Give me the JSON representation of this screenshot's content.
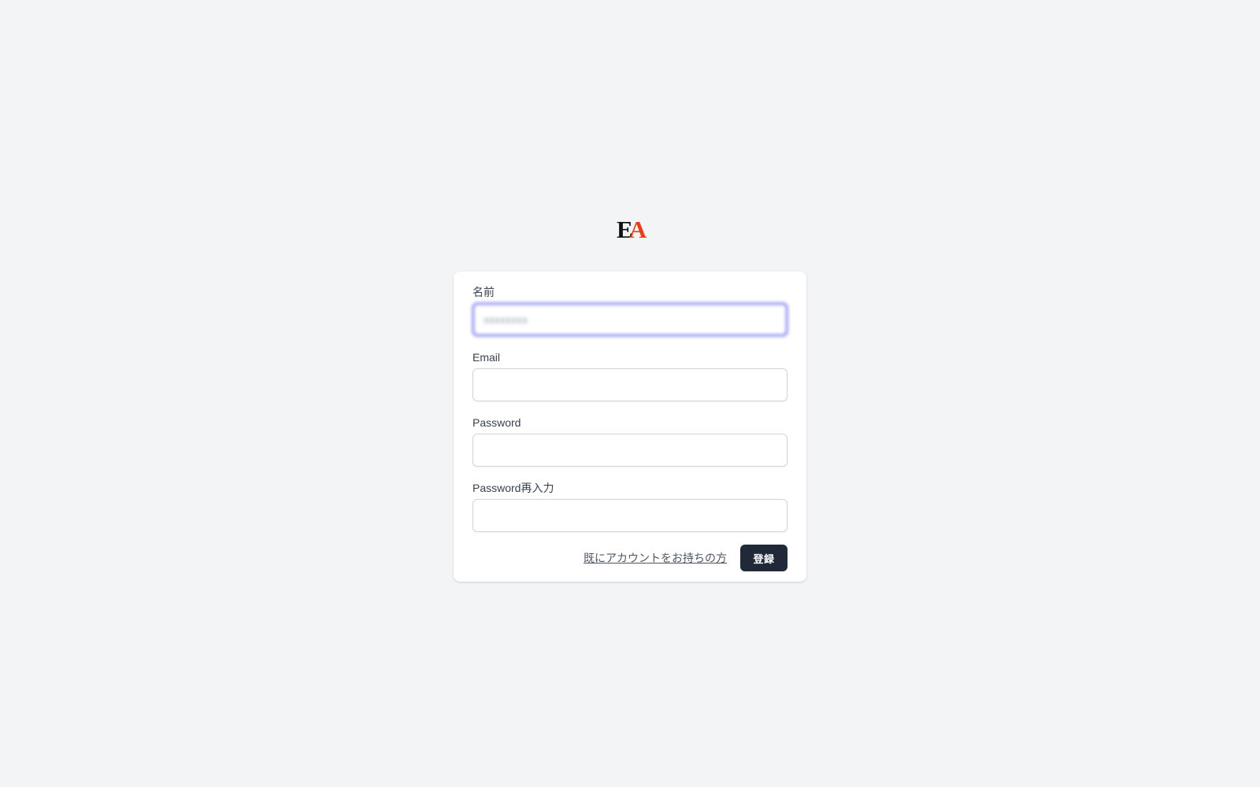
{
  "logo": {
    "text_e": "E",
    "text_a": "A",
    "colors": {
      "e": "#111111",
      "a": "#ef3b0f"
    }
  },
  "form": {
    "name": {
      "label": "名前",
      "value": "xxxxxxxx"
    },
    "email": {
      "label": "Email",
      "value": ""
    },
    "password": {
      "label": "Password",
      "value": ""
    },
    "password_confirm": {
      "label": "Password再入力",
      "value": ""
    },
    "login_link": "既にアカウントをお持ちの方",
    "submit_label": "登録"
  },
  "colors": {
    "background": "#f3f4f6",
    "card": "#ffffff",
    "focus_ring": "#6366f1",
    "button": "#1f2937"
  }
}
